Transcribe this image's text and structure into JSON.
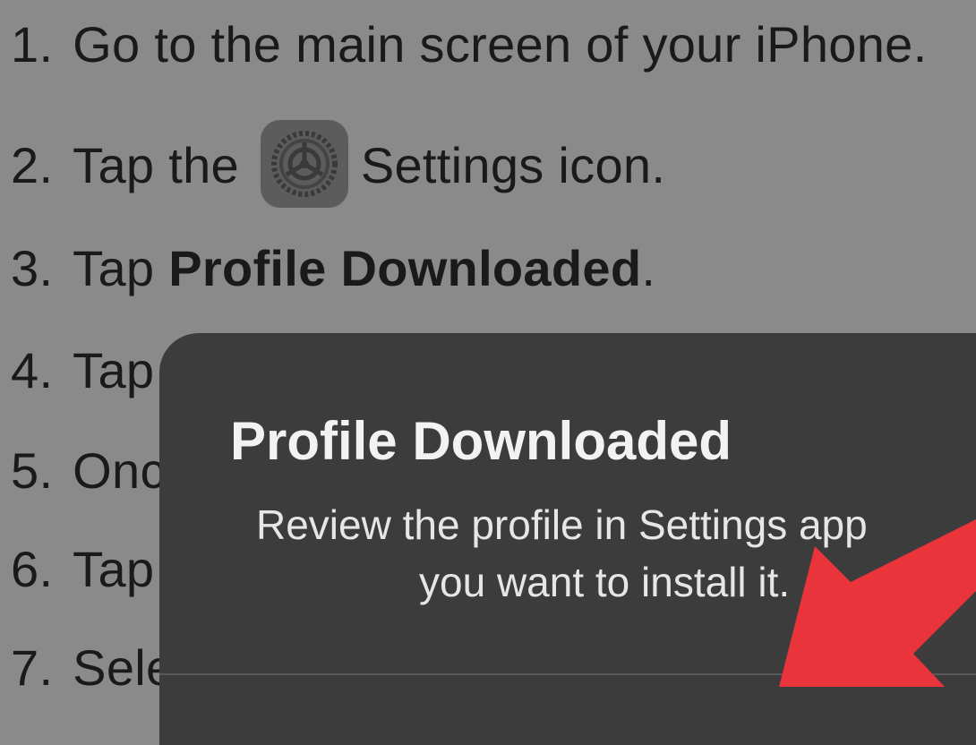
{
  "instructions": {
    "step1": {
      "num": "1.",
      "text": "Go to the main screen of your iPhone."
    },
    "step2": {
      "num": "2.",
      "before": "Tap the",
      "icon": "settings-gear-icon",
      "after": "Settings icon."
    },
    "step3": {
      "num": "3.",
      "before": "Tap",
      "bold": "Profile Downloaded",
      "after": "."
    },
    "step4": {
      "num": "4.",
      "text": "Tap"
    },
    "step5": {
      "num": "5.",
      "text": "Onc"
    },
    "step6": {
      "num": "6.",
      "text": "Tap"
    },
    "step7": {
      "num": "7.",
      "text": "Sele"
    }
  },
  "alert": {
    "title": "Profile Downloaded",
    "message_line1": "Review the profile in Settings app",
    "message_line2": "you want to install it."
  },
  "colors": {
    "background": "#8a8a8a",
    "alert_background": "#3c3c3c",
    "arrow": "#e8343a"
  },
  "annotation": {
    "icon": "red-arrow-icon"
  }
}
